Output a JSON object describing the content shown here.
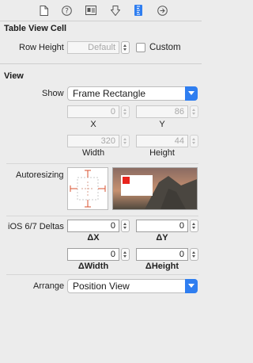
{
  "toolbar": {
    "icons": [
      "file-icon",
      "help-icon",
      "identity-icon",
      "attributes-icon",
      "size-ruler-icon",
      "connections-icon"
    ],
    "selected_index": 4
  },
  "table_view_cell": {
    "title": "Table View Cell",
    "row_height_label": "Row Height",
    "row_height_placeholder": "Default",
    "custom_label": "Custom",
    "custom_checked": false
  },
  "view": {
    "title": "View",
    "show_label": "Show",
    "show_value": "Frame Rectangle",
    "x_value": "0",
    "x_label": "X",
    "y_value": "86",
    "y_label": "Y",
    "width_value": "320",
    "width_label": "Width",
    "height_value": "44",
    "height_label": "Height",
    "autoresizing_label": "Autoresizing",
    "deltas_label": "iOS 6/7 Deltas",
    "dx_value": "0",
    "dx_label": "ΔX",
    "dy_value": "0",
    "dy_label": "ΔY",
    "dwidth_value": "0",
    "dwidth_label": "ΔWidth",
    "dheight_value": "0",
    "dheight_label": "ΔHeight",
    "arrange_label": "Arrange",
    "arrange_value": "Position View"
  },
  "colors": {
    "accent": "#2f7ef0",
    "strut": "#d9502f",
    "preview_red": "#e8241c"
  }
}
